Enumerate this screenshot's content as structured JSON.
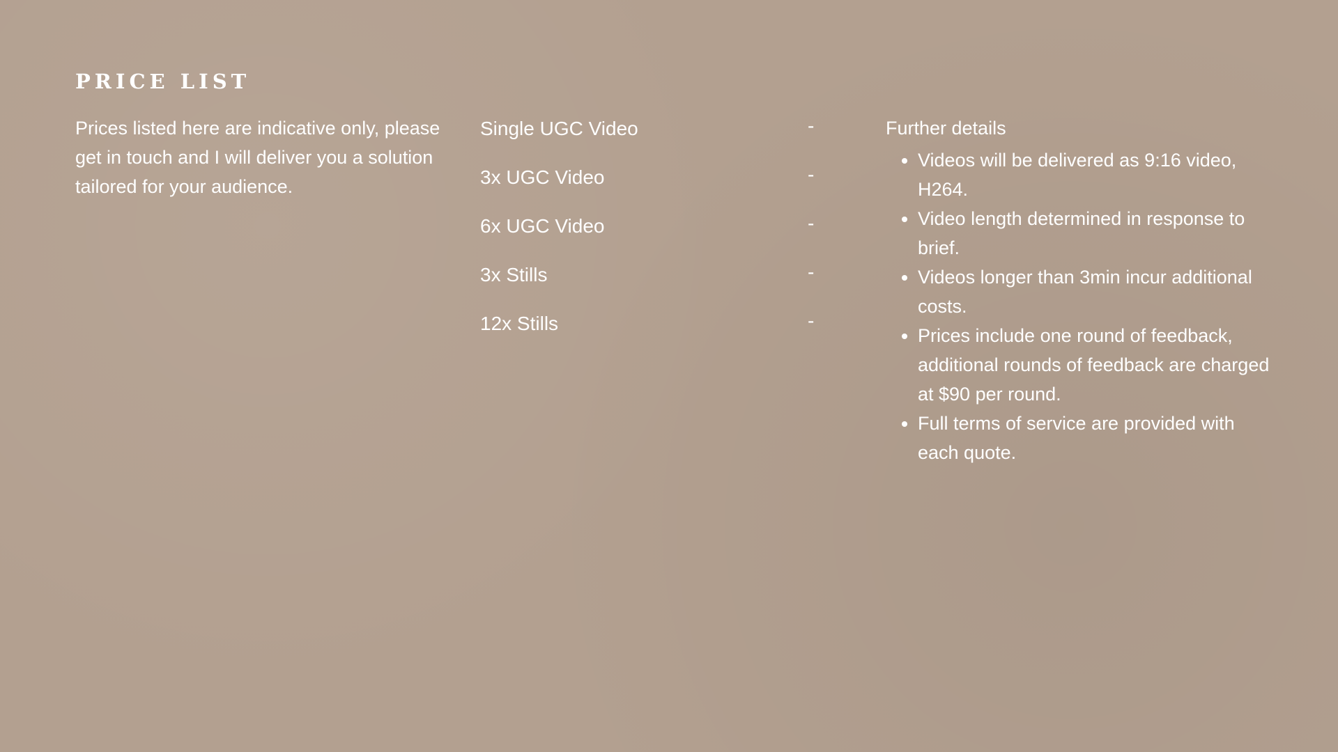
{
  "page": {
    "title": "PRICE LIST",
    "intro": "Prices listed here are indicative only, please get in touch and I will deliver you a solution tailored for your audience."
  },
  "prices": [
    {
      "name": "Single UGC Video",
      "price": "-"
    },
    {
      "name": "3x UGC Video",
      "price": "-"
    },
    {
      "name": "6x UGC Video",
      "price": "-"
    },
    {
      "name": "3x Stills",
      "price": "-"
    },
    {
      "name": "12x Stills",
      "price": "-"
    }
  ],
  "details": {
    "heading": "Further details",
    "items": [
      "Videos will be delivered as 9:16 video, H264.",
      "Video length determined in response to brief.",
      "Videos longer than 3min incur additional costs.",
      "Prices include one round of feedback, additional rounds of feedback are charged at $90 per round.",
      "Full terms of service are provided with each quote."
    ]
  },
  "colors": {
    "background": "#b3a090",
    "text": "#ffffff"
  }
}
